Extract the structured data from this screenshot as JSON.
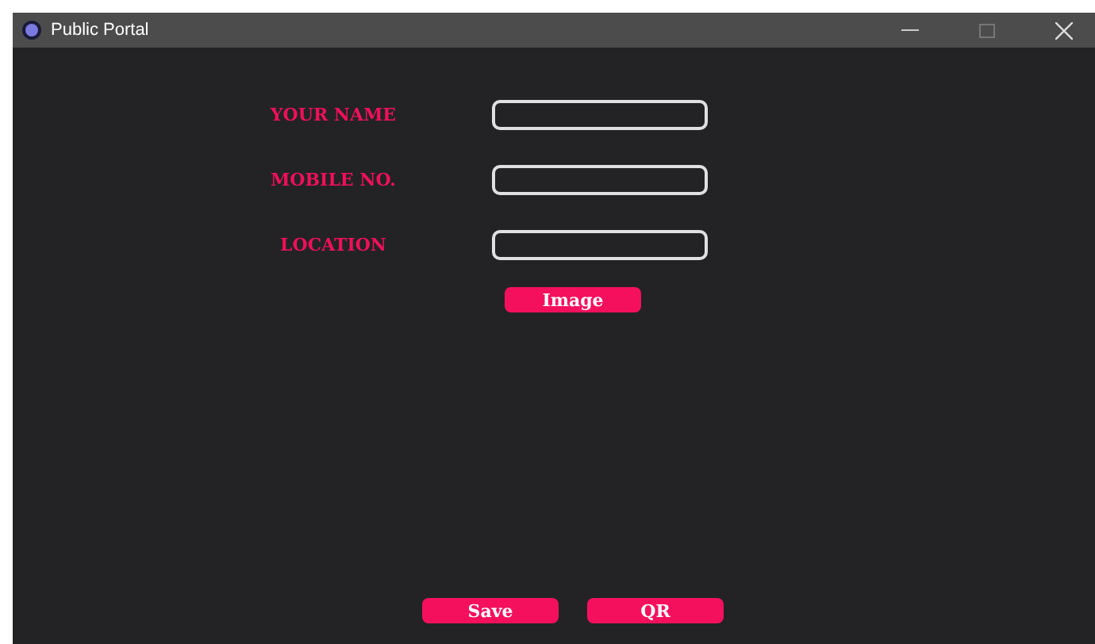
{
  "window": {
    "title": "Public Portal"
  },
  "fields": [
    {
      "label": "YOUR NAME"
    },
    {
      "label": "MOBILE NO."
    },
    {
      "label": "LOCATION"
    }
  ],
  "image_button": "Image",
  "buttons": [
    "Save",
    "QR"
  ]
}
